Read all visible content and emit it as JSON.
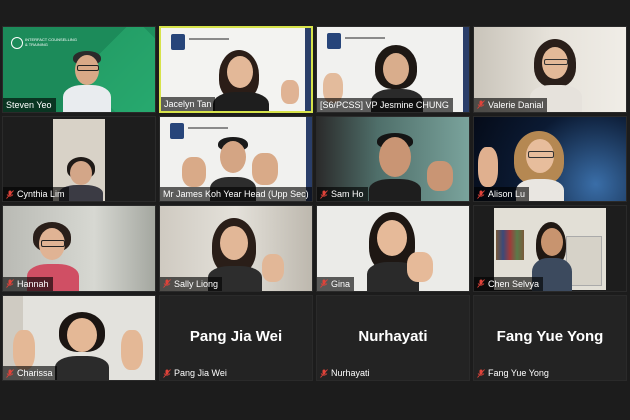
{
  "tiles": [
    {
      "label": "Steven Yeo",
      "muted": false,
      "video": true,
      "brand": "INTERFACT COUNSELLING & TRAINING"
    },
    {
      "label": "Jacelyn Tan",
      "muted": false,
      "video": true
    },
    {
      "label": "[S6/PCSS] VP Jesmine CHUNG",
      "muted": false,
      "video": true
    },
    {
      "label": "Valerie Danial",
      "muted": true,
      "video": true
    },
    {
      "label": "Cynthia Lim",
      "muted": true,
      "video": true
    },
    {
      "label": "Mr James Koh Year Head (Upp Sec)",
      "muted": false,
      "video": true
    },
    {
      "label": "Sam Ho",
      "muted": true,
      "video": true
    },
    {
      "label": "Alison Lu",
      "muted": true,
      "video": true
    },
    {
      "label": "Hannah",
      "muted": true,
      "video": true
    },
    {
      "label": "Sally Liong",
      "muted": true,
      "video": true
    },
    {
      "label": "Gina",
      "muted": true,
      "video": true
    },
    {
      "label": "Chen Selvya",
      "muted": true,
      "video": true
    },
    {
      "label": "Charissa",
      "muted": true,
      "video": true
    },
    {
      "label": "Pang Jia Wei",
      "muted": true,
      "video": false,
      "display": "Pang Jia Wei"
    },
    {
      "label": "Nurhayati",
      "muted": true,
      "video": false,
      "display": "Nurhayati"
    },
    {
      "label": "Fang Yue Yong",
      "muted": true,
      "video": false,
      "display": "Fang Yue Yong"
    }
  ],
  "colors": {
    "active_speaker": "#d7e34a",
    "muted_icon": "#e0433a",
    "brand_green": "#1c8b5a"
  },
  "icons": {
    "muted": "mic-muted-icon"
  }
}
